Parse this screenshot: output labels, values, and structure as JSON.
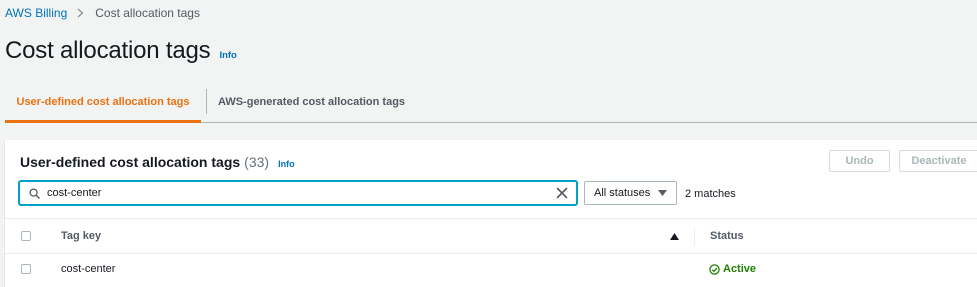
{
  "breadcrumb": {
    "items": [
      {
        "label": "AWS Billing"
      },
      {
        "label": "Cost allocation tags"
      }
    ]
  },
  "header": {
    "title": "Cost allocation tags",
    "info": "Info"
  },
  "tabs": [
    {
      "label": "User-defined cost allocation tags",
      "active": true
    },
    {
      "label": "AWS-generated cost allocation tags",
      "active": false
    }
  ],
  "panel": {
    "title": "User-defined cost allocation tags",
    "count": "(33)",
    "info": "Info",
    "undo_label": "Undo",
    "deactivate_label": "Deactivate",
    "search": {
      "value": "cost-center",
      "placeholder": ""
    },
    "status_filter": {
      "selected": "All statuses"
    },
    "matches": "2 matches",
    "columns": [
      "Tag key",
      "Status"
    ],
    "rows": [
      {
        "tag_key": "cost-center",
        "status": "Active"
      }
    ]
  },
  "icons": [
    "chevron-right-icon",
    "search-icon",
    "clear-icon",
    "caret-down-icon",
    "sort-ascending-icon",
    "check-circle-icon"
  ],
  "colors": {
    "accent": "#ec7211",
    "link": "#0073bb",
    "success": "#1d8102",
    "focus": "#00a1c9",
    "background": "#f2f3f3"
  }
}
